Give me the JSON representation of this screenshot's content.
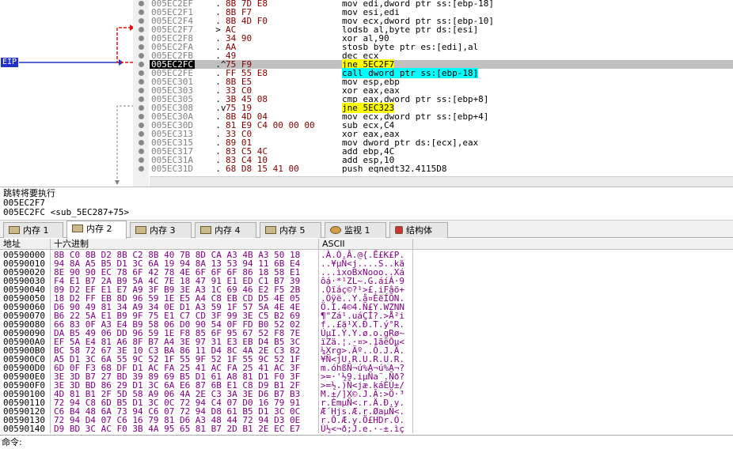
{
  "eip_label": "EIP",
  "disasm_rows": [
    {
      "addr": "005EC2EF",
      "mk": "  .",
      "hex": "8B 7D E8",
      "ins": "mov edi,dword ptr ss:[ebp-18]"
    },
    {
      "addr": "005EC2F1",
      "mk": "  .",
      "hex": "8B F7",
      "ins": "mov esi,edi"
    },
    {
      "addr": "005EC2F4",
      "mk": "  .",
      "hex": "8B 4D F0",
      "ins": "mov ecx,dword ptr ss:[ebp-10]"
    },
    {
      "addr": "005EC2F7",
      "mk": "  >",
      "hex": "AC",
      "ins": "lodsb al,byte ptr ds:[esi]"
    },
    {
      "addr": "005EC2F8",
      "mk": "  .",
      "hex": "34 90",
      "ins": "xor al,90"
    },
    {
      "addr": "005EC2FA",
      "mk": "  .",
      "hex": "AA",
      "ins": "stosb byte ptr es:[edi],al"
    },
    {
      "addr": "005EC2FB",
      "mk": "  .",
      "hex": "49",
      "ins": "dec ecx"
    },
    {
      "addr": "005EC2FC",
      "mk": "  .^",
      "hex": "75 F9",
      "ins": "jne 5EC2F7",
      "sel": true,
      "jmp": true
    },
    {
      "addr": "005EC2FE",
      "mk": "  .",
      "hex": "FF 55 E8",
      "ins": "call dword ptr ss:[ebp-18]",
      "call": true
    },
    {
      "addr": "005EC301",
      "mk": "  .",
      "hex": "8B E5",
      "ins": "mov esp,ebp"
    },
    {
      "addr": "005EC303",
      "mk": "  .",
      "hex": "33 C0",
      "ins": "xor eax,eax"
    },
    {
      "addr": "005EC305",
      "mk": "  .",
      "hex": "3B 45 08",
      "ins": "cmp eax,dword ptr ss:[ebp+8]"
    },
    {
      "addr": "005EC308",
      "mk": "  .v",
      "hex": "75 19",
      "ins": "jne 5EC323",
      "jmp": true
    },
    {
      "addr": "005EC30A",
      "mk": "  .",
      "hex": "8B 4D 04",
      "ins": "mov ecx,dword ptr ss:[ebp+4]"
    },
    {
      "addr": "005EC30D",
      "mk": "  .",
      "hex": "81 E9 C4 00 00 00",
      "ins": "sub ecx,C4"
    },
    {
      "addr": "005EC313",
      "mk": "  .",
      "hex": "33 C0",
      "ins": "xor eax,eax"
    },
    {
      "addr": "005EC315",
      "mk": "  .",
      "hex": "89 01",
      "ins": "mov dword ptr ds:[ecx],eax"
    },
    {
      "addr": "005EC317",
      "mk": "  .",
      "hex": "83 C5 4C",
      "ins": "add ebp,4C"
    },
    {
      "addr": "005EC31A",
      "mk": "  .",
      "hex": "83 C4 10",
      "ins": "add esp,10"
    },
    {
      "addr": "005EC31D",
      "mk": "  .",
      "hex": "68 D8 15 41 00",
      "ins": "push eqnedt32.4115D8",
      "push": true
    }
  ],
  "info_lines": [
    "跳转将要执行",
    "005EC2F7",
    "005EC2FC <sub_5EC287+75>"
  ],
  "tabs": [
    {
      "label": "内存 1",
      "icon": "memory-chip-icon"
    },
    {
      "label": "内存 2",
      "icon": "memory-chip-icon",
      "active": true
    },
    {
      "label": "内存 3",
      "icon": "memory-chip-icon"
    },
    {
      "label": "内存 4",
      "icon": "memory-chip-icon"
    },
    {
      "label": "内存 5",
      "icon": "memory-chip-icon"
    },
    {
      "label": "监视 1",
      "icon": "watch-icon"
    },
    {
      "label": "结构体",
      "icon": "struct-icon"
    }
  ],
  "mem_headers": {
    "addr": "地址",
    "hex": "十六进制",
    "ascii": "ASCII"
  },
  "mem_rows": [
    {
      "addr": "00590000",
      "hex": "8B C0 8B D2 8B C2 8B 40 7B 8D CA A3 4B A3 50 18",
      "ascii": ".À.Ò.Â.@{.Ê£K£P."
    },
    {
      "addr": "00590010",
      "hex": "94 8A A5 B5 D1 3C 6A 19 94 8A 13 53 94 11 6B E4",
      "ascii": "..¥µÑ<j....S..kä"
    },
    {
      "addr": "00590020",
      "hex": "8E 90 90 EC 78 6F 42 78 4E 6F 6F 6F 86 18 58 E1",
      "ascii": "...ìxoBxNooo..Xá"
    },
    {
      "addr": "00590030",
      "hex": "F4 E1 B7 2A B9 5A 4C 7E 18 47 91 E1 ED C1 B7 39",
      "ascii": "ôá·*¹ZL~.G.áíÁ·9"
    },
    {
      "addr": "00590040",
      "hex": "89 D2 EF E1 E7 A9 3F B9 3E A3 1C 69 46 E2 F5 2B",
      "ascii": ".Òïáç©?¹>£.iFâõ+"
    },
    {
      "addr": "00590050",
      "hex": "18 D2 FF EB 8D 96 59 1E E5 A4 C8 EB CD D5 4E 05",
      "ascii": ".Òÿë..Y.å¤ÈëÍÕN."
    },
    {
      "addr": "00590060",
      "hex": "D6 90 49 81 34 A9 34 0E D1 A3 59 1F 57 5A 4E 4E",
      "ascii": "Ö.I.4©4.Ñ£Y.WZNN"
    },
    {
      "addr": "00590070",
      "hex": "B6 22 5A E1 B9 9F 75 E1 C7 CD 3F 99 3E C5 B2 69",
      "ascii": "¶\"Zá¹.uáÇÍ?.>Å²i"
    },
    {
      "addr": "00590080",
      "hex": "66 83 0F A3 E4 B9 58 06 D0 90 54 0F FD B0 52 02",
      "ascii": "f..£ä¹X.Ð.T.ý°R."
    },
    {
      "addr": "00590090",
      "hex": "DA B5 49 06 DD 96 59 1E F8 85 6F 95 67 52 F8 7E",
      "ascii": "ÚµI.Ý.Y.ø.o.gRø~"
    },
    {
      "addr": "005900A0",
      "hex": "EF 5A E4 81 A6 8F B7 A4 3E 97 31 E3 EB D4 B5 3C",
      "ascii": "ïZä.¦.·¤>.1ãëÔµ<"
    },
    {
      "addr": "005900B0",
      "hex": "BC 58 72 67 3E 10 C3 BA 86 11 D4 8C 4A 2E C3 82",
      "ascii": "¼Xrg>.Ãº..Ô.J.Ã."
    },
    {
      "addr": "005900C0",
      "hex": "A5 D1 3C 6A 55 9C 52 1F 55 9F 52 1F 55 9C 52 1F",
      "ascii": "¥Ñ<jU.R.U.R.U.R."
    },
    {
      "addr": "005900D0",
      "hex": "6D 0F F3 68 DF D1 AC FA 25 41 AC FA 25 41 AC 3F",
      "ascii": "m.óhßÑ¬ú%A¬ú%A¬?"
    },
    {
      "addr": "005900E0",
      "hex": "3E 3D B7 27 BD 39 89 69 B5 D1 61 A8 81 D1 F0 3F",
      "ascii": ">=·'½9.iµÑa¨.Ñð?"
    },
    {
      "addr": "005900F0",
      "hex": "3E 3D BD 86 29 D1 3C 6A E6 87 6B E1 C8 D9 B1 2F",
      "ascii": ">=½.)Ñ<jæ.káÈÙ±/"
    },
    {
      "addr": "00590100",
      "hex": "4D 81 B1 2F 5D 58 A9 06 4A 2E C3 3A 3E D6 B7 B3",
      "ascii": "M.±/]X©.J.Ã:>Ö·³"
    },
    {
      "addr": "00590110",
      "hex": "72 94 C8 6D B5 D1 3C 0C 72 94 C4 07 D0 16 79 91",
      "ascii": "r.ÈmµÑ<.r.Ä.Ð.y."
    },
    {
      "addr": "00590120",
      "hex": "C6 B4 48 6A 73 94 C6 07 72 94 D8 61 B5 D1 3C 0C",
      "ascii": "Æ´Hjs.Æ.r.ØaµÑ<."
    },
    {
      "addr": "00590130",
      "hex": "72 94 D4 07 C6 16 79 81 D6 A3 48 44 72 94 D3 0E",
      "ascii": "r.Ô.Æ.y.Ö£HDr.Ó."
    },
    {
      "addr": "00590140",
      "hex": "D9 BD 3C AC F0 3B 4A 95 65 81 B7 2D B1 2E EC E7",
      "ascii": "Ù½<¬ð;J.e.·-±.ìç"
    }
  ],
  "cmd_label": "命令:",
  "cmd_value": ""
}
